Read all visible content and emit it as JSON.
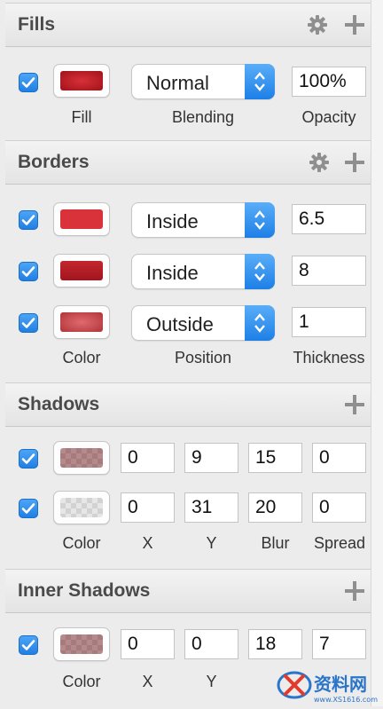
{
  "fills": {
    "title": "Fills",
    "rows": [
      {
        "checked": true,
        "color": "#b81a22",
        "blending": "Normal",
        "opacity": "100%"
      }
    ],
    "captions": {
      "color": "Fill",
      "blending": "Blending",
      "opacity": "Opacity"
    }
  },
  "borders": {
    "title": "Borders",
    "rows": [
      {
        "checked": true,
        "color": "#d9323a",
        "position": "Inside",
        "thickness": "6.5"
      },
      {
        "checked": true,
        "color": "#b41c24",
        "position": "Inside",
        "thickness": "8"
      },
      {
        "checked": true,
        "color": "#c6484c",
        "position": "Outside",
        "thickness": "1"
      }
    ],
    "captions": {
      "color": "Color",
      "position": "Position",
      "thickness": "Thickness"
    }
  },
  "shadows": {
    "title": "Shadows",
    "rows": [
      {
        "checked": true,
        "color": "#b07c7e",
        "x": "0",
        "y": "9",
        "blur": "15",
        "spread": "0"
      },
      {
        "checked": true,
        "color": "#d9d9d9",
        "x": "0",
        "y": "31",
        "blur": "20",
        "spread": "0"
      }
    ],
    "captions": {
      "color": "Color",
      "x": "X",
      "y": "Y",
      "blur": "Blur",
      "spread": "Spread"
    }
  },
  "inner_shadows": {
    "title": "Inner Shadows",
    "rows": [
      {
        "checked": true,
        "color": "#b07c7e",
        "x": "0",
        "y": "0",
        "blur": "18",
        "spread": "7"
      }
    ],
    "captions": {
      "color": "Color",
      "x": "X",
      "y": "Y"
    }
  },
  "icons": {
    "settings": "gear-icon",
    "add": "plus-icon",
    "check": "checkmark-icon",
    "stepper": "up-down-chevron-icon"
  },
  "accent_color": "#2b87ea",
  "watermark": {
    "text": "资料网",
    "subtext": "www.XS1616.com"
  }
}
